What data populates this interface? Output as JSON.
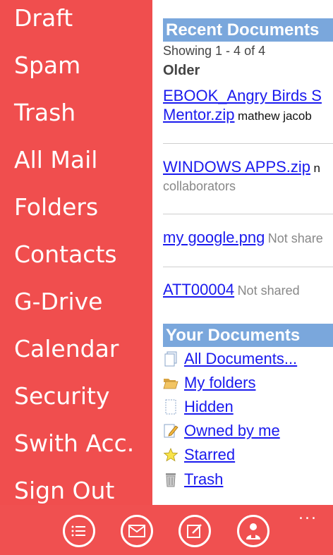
{
  "sidebar": {
    "items": [
      {
        "label": "Draft"
      },
      {
        "label": "Spam"
      },
      {
        "label": "Trash"
      },
      {
        "label": "All Mail"
      },
      {
        "label": "Folders"
      },
      {
        "label": "Contacts"
      },
      {
        "label": "G-Drive"
      },
      {
        "label": "Calendar"
      },
      {
        "label": "Security"
      },
      {
        "label": "Swith Acc."
      },
      {
        "label": "Sign Out"
      }
    ]
  },
  "recent": {
    "header": "Recent Documents",
    "showing": "Showing 1 - 4 of 4",
    "group": "Older",
    "docs": [
      {
        "line1": "EBOOK_Angry Birds S",
        "line2": "Mentor.zip",
        "meta": "mathew jacob"
      },
      {
        "line1": "WINDOWS APPS.zip",
        "meta_inline": "n",
        "meta2": "collaborators"
      },
      {
        "line1": "my google.png",
        "meta": "Not share"
      },
      {
        "line1": "ATT00004",
        "meta": "Not shared"
      }
    ]
  },
  "yours": {
    "header": "Your Documents",
    "items": [
      {
        "label": "All Documents...",
        "icon": "document-stack-icon"
      },
      {
        "label": "My folders",
        "icon": "open-folder-icon"
      },
      {
        "label": "Hidden",
        "icon": "hidden-document-icon"
      },
      {
        "label": "Owned by me",
        "icon": "pencil-document-icon"
      },
      {
        "label": "Starred",
        "icon": "star-icon"
      },
      {
        "label": "Trash",
        "icon": "trash-can-icon"
      }
    ]
  },
  "appbar": {
    "more": "...",
    "buttons": [
      "list-icon",
      "mail-icon",
      "compose-icon",
      "contact-icon"
    ]
  },
  "colors": {
    "accent": "#f05050",
    "header_blue": "#7aa7dc",
    "link": "#1a1aee"
  }
}
